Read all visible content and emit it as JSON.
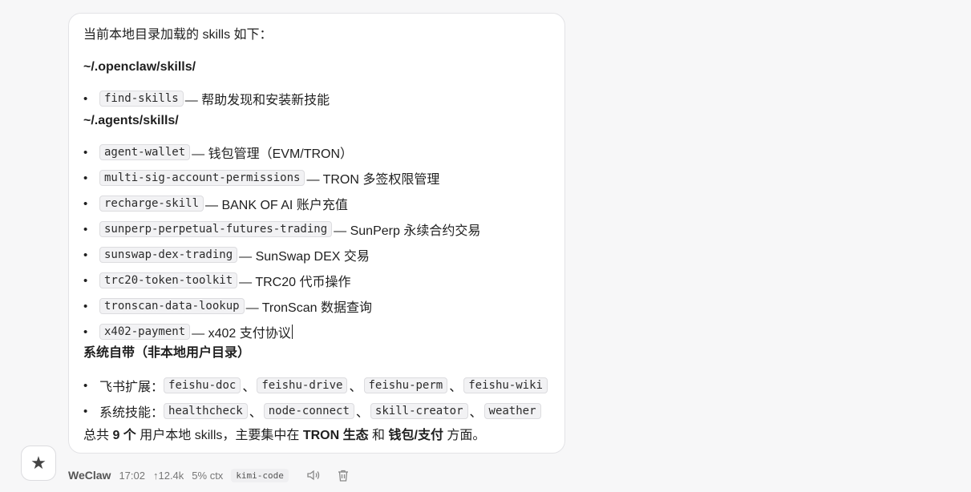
{
  "message": {
    "intro": "当前本地目录加载的 skills 如下：",
    "sections": [
      {
        "heading": "~/.openclaw/skills/",
        "items": [
          {
            "code": "find-skills",
            "desc": "— 帮助发现和安装新技能"
          }
        ]
      },
      {
        "heading": "~/.agents/skills/",
        "items": [
          {
            "code": "agent-wallet",
            "desc": "— 钱包管理（EVM/TRON）"
          },
          {
            "code": "multi-sig-account-permissions",
            "desc": "— TRON 多签权限管理"
          },
          {
            "code": "recharge-skill",
            "desc": "— BANK OF AI 账户充值"
          },
          {
            "code": "sunperp-perpetual-futures-trading",
            "desc": "— SunPerp 永续合约交易"
          },
          {
            "code": "sunswap-dex-trading",
            "desc": "— SunSwap DEX 交易"
          },
          {
            "code": "trc20-token-toolkit",
            "desc": "— TRC20 代币操作"
          },
          {
            "code": "tronscan-data-lookup",
            "desc": "— TronScan 数据查询"
          },
          {
            "code": "x402-payment",
            "desc": "— x402 支付协议"
          }
        ]
      },
      {
        "heading": "系统自带（非本地用户目录）",
        "groups": [
          {
            "label": "飞书扩展：",
            "codes": [
              "feishu-doc",
              "feishu-drive",
              "feishu-perm",
              "feishu-wiki"
            ]
          },
          {
            "label": "系统技能：",
            "codes": [
              "healthcheck",
              "node-connect",
              "skill-creator",
              "weather"
            ]
          }
        ]
      }
    ],
    "separator": "、",
    "bullet": "•",
    "summary": {
      "p1": "总共 ",
      "b1": "9 个",
      "p2": " 用户本地 skills，主要集中在 ",
      "b2": "TRON 生态",
      "p3": " 和 ",
      "b3": "钱包/支付",
      "p4": " 方面。"
    }
  },
  "meta": {
    "avatar_icon": "star-icon",
    "avatar_glyph": "★",
    "name": "WeClaw",
    "time": "17:02",
    "tokens": "↑12.4k",
    "ctx": "5% ctx",
    "model": "kimi-code",
    "speaker_icon": "speaker-icon",
    "delete_icon": "trash-icon"
  }
}
